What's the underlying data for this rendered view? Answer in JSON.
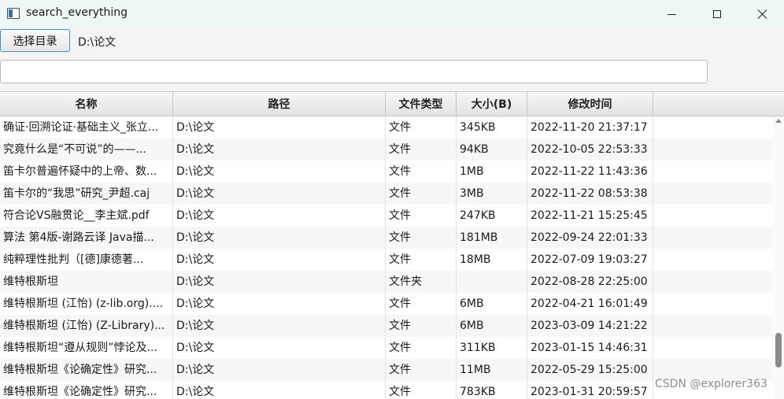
{
  "window": {
    "title": "search_everything",
    "icon": "app-window-icon",
    "controls": [
      "minimize-icon",
      "maximize-icon",
      "close-icon"
    ]
  },
  "toolbar": {
    "choose_dir_label": "选择目录",
    "current_dir": "D:\\论文"
  },
  "search": {
    "value": "",
    "placeholder": ""
  },
  "table": {
    "columns": [
      "名称",
      "路径",
      "文件类型",
      "大小(B)",
      "修改时间",
      ""
    ],
    "rows": [
      [
        "确证·回溯论证·基础主义_张立...",
        "D:\\论文",
        "文件",
        "345KB",
        "2022-11-20 21:37:17"
      ],
      [
        "究竟什么是“不可说”的——...",
        "D:\\论文",
        "文件",
        "94KB",
        "2022-10-05 22:53:33"
      ],
      [
        "笛卡尔普遍怀疑中的上帝、数...",
        "D:\\论文",
        "文件",
        "1MB",
        "2022-11-22 11:43:36"
      ],
      [
        "笛卡尔的“我思”研究_尹超.caj",
        "D:\\论文",
        "文件",
        "3MB",
        "2022-11-22 08:53:38"
      ],
      [
        "符合论VS融贯论__李主斌.pdf",
        "D:\\论文",
        "文件",
        "247KB",
        "2022-11-21 15:25:45"
      ],
      [
        "算法 第4版-谢路云译 Java描...",
        "D:\\论文",
        "文件",
        "181MB",
        "2022-09-24 22:01:33"
      ],
      [
        "纯粹理性批判（[德]康德著...",
        "D:\\论文",
        "文件",
        "18MB",
        "2022-07-09 19:03:27"
      ],
      [
        "维特根斯坦",
        "D:\\论文",
        "文件夹",
        "",
        "2022-08-28 22:25:00"
      ],
      [
        "维特根斯坦 (江怡) (z-lib.org)....",
        "D:\\论文",
        "文件",
        "6MB",
        "2022-04-21 16:01:49"
      ],
      [
        "维特根斯坦 (江怡) (Z-Library)...",
        "D:\\论文",
        "文件",
        "6MB",
        "2023-03-09 14:21:22"
      ],
      [
        "维特根斯坦“遵从规则”悖论及...",
        "D:\\论文",
        "文件",
        "311KB",
        "2023-01-15 14:46:31"
      ],
      [
        "维特根斯坦《论确定性》研究...",
        "D:\\论文",
        "文件",
        "11MB",
        "2022-05-29 15:25:00"
      ],
      [
        "维特根斯坦《论确定性》研究...",
        "D:\\论文",
        "文件",
        "783KB",
        "2023-01-31 20:59:57"
      ]
    ]
  },
  "watermark": "CSDN @explorer363"
}
